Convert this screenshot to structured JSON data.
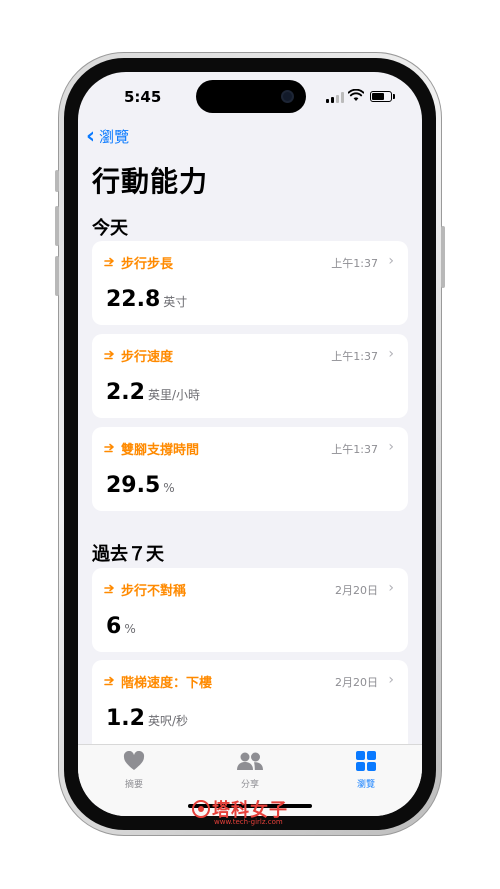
{
  "status_bar": {
    "time": "5:45"
  },
  "nav": {
    "back_label": "瀏覽"
  },
  "page": {
    "title": "行動能力"
  },
  "sections": {
    "today": "今天",
    "past_7_days": "過去７天"
  },
  "cards": [
    {
      "metric": "步行步長",
      "date": "上午1:37",
      "value": "22.8",
      "unit": "英寸"
    },
    {
      "metric": "步行速度",
      "date": "上午1:37",
      "value": "2.2",
      "unit": "英里/小時"
    },
    {
      "metric": "雙腳支撐時間",
      "date": "上午1:37",
      "value": "29.5",
      "unit": "%"
    },
    {
      "metric": "步行不對稱",
      "date": "2月20日",
      "value": "6",
      "unit": "%"
    },
    {
      "metric": "階梯速度：下樓",
      "date": "2月20日",
      "value": "1.2",
      "unit": "英呎/秒"
    }
  ],
  "tab_bar": {
    "tabs": [
      {
        "label": "摘要",
        "icon": "heart-icon"
      },
      {
        "label": "分享",
        "icon": "people-icon"
      },
      {
        "label": "瀏覽",
        "icon": "grid-icon"
      }
    ],
    "active": "瀏覽"
  },
  "watermark": {
    "title": "塔科女子",
    "url": "www.tech-girlz.com"
  },
  "colors": {
    "accent_blue": "#0a7aff",
    "metric_orange": "#ff8a00",
    "background": "#f2f2f7",
    "card": "#ffffff",
    "watermark_red": "#e5403a"
  }
}
